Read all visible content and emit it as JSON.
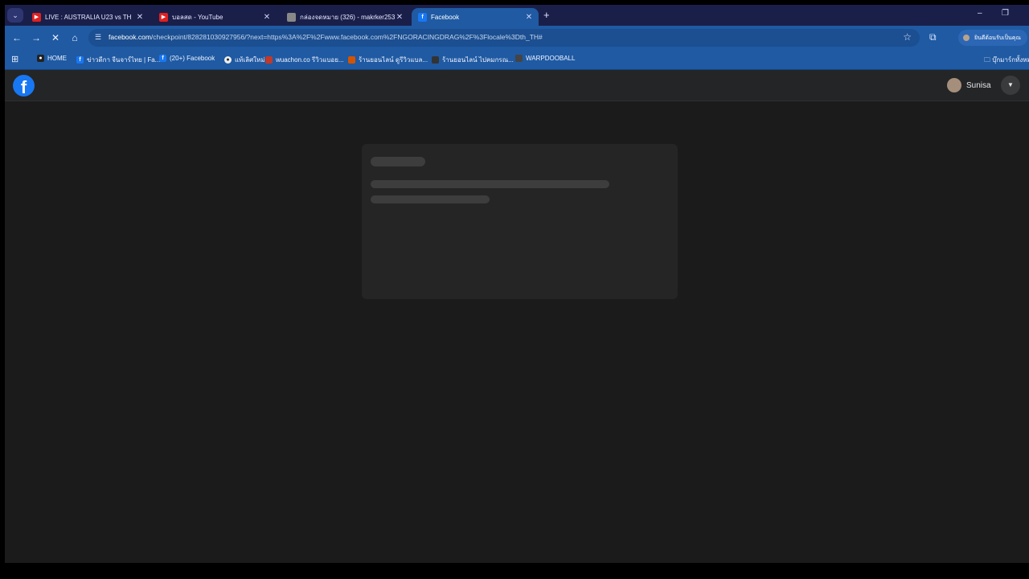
{
  "browser": {
    "tabs": [
      {
        "title": "LIVE : AUSTRALIA U23 vs TH",
        "favicon": "youtube-icon",
        "active": false
      },
      {
        "title": "บอลสด - YouTube",
        "favicon": "youtube-icon",
        "active": false
      },
      {
        "title": "กล่องจดหมาย (326) - makrker253",
        "favicon": "mail-icon",
        "active": false
      },
      {
        "title": "Facebook",
        "favicon": "facebook-icon",
        "active": true
      }
    ],
    "new_tab_symbol": "+",
    "close_symbol": "✕",
    "window_controls": {
      "minimize": "–",
      "restore": "❐",
      "close": "✕"
    },
    "url_host": "facebook.com",
    "url_rest": "/checkpoint/828281030927956/?next=https%3A%2F%2Fwww.facebook.com%2FNGORACINGDRAG%2F%3Flocale%3Dth_TH#",
    "profile_label": "ยินดีต้อนรับเป็นคุณ",
    "bookmarks": [
      {
        "label": "HOME",
        "icon": "site-icon"
      },
      {
        "label": "ข่าวดีกา จีนจาร์ไทย | Fa...",
        "icon": "facebook-icon"
      },
      {
        "label": "(20+) Facebook",
        "icon": "facebook-icon"
      },
      {
        "label": "แท้เลิศใหม่",
        "icon": "site-icon"
      },
      {
        "label": "wuachon.co รีวิวแบอย...",
        "icon": "site-icon"
      },
      {
        "label": "ร้านยอนไลน์ ดูรีวิวแบล...",
        "icon": "site-icon"
      },
      {
        "label": "ร้านยอนไลน์ ไปคมกรณ...",
        "icon": "site-icon"
      },
      {
        "label": "WARPDOOBALL",
        "icon": "site-icon"
      }
    ],
    "bookmarks_right": "บุ๊กมาร์กทั้งหมด"
  },
  "facebook": {
    "logo": "f",
    "user_name": "Sunisa"
  },
  "colors": {
    "tabstrip": "#1a1f4a",
    "toolbar": "#1f5aa3",
    "fb_blue": "#1877f2",
    "page_bg": "#1b1b1b",
    "card_bg": "#252525",
    "skeleton": "#3d3d3d"
  }
}
